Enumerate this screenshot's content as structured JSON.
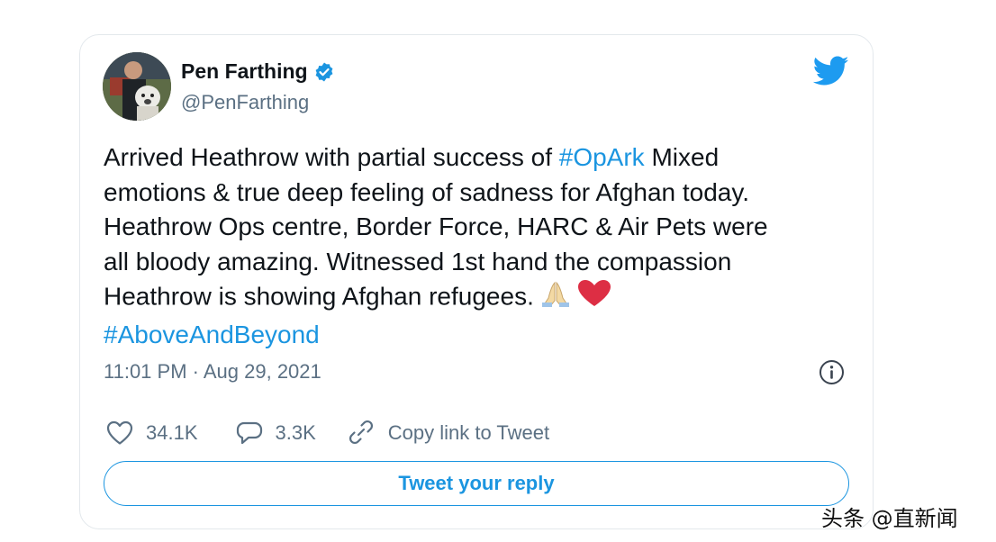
{
  "tweet": {
    "author": {
      "name": "Pen Farthing",
      "handle": "@PenFarthing",
      "verified": true
    },
    "text_lines": [
      [
        {
          "t": "Arrived Heathrow with partial success of ",
          "tag": false
        },
        {
          "t": "#OpArk",
          "tag": true
        },
        {
          "t": " Mixed",
          "tag": false
        }
      ],
      [
        {
          "t": "emotions & true deep feeling of sadness for Afghan today.",
          "tag": false
        }
      ],
      [
        {
          "t": "Heathrow Ops centre, Border Force, HARC & Air Pets were",
          "tag": false
        }
      ],
      [
        {
          "t": "all bloody amazing. Witnessed 1st hand the compassion",
          "tag": false
        }
      ],
      [
        {
          "t": "Heathrow is showing Afghan refugees.",
          "tag": false
        }
      ],
      [
        {
          "t": "#AboveAndBeyond",
          "tag": true
        }
      ]
    ],
    "emojis": [
      "folded-hands",
      "red-heart"
    ],
    "timestamp": "11:01 PM · Aug 29, 2021",
    "likes": "34.1K",
    "replies": "3.3K",
    "copy_link_label": "Copy link to Tweet",
    "reply_button_label": "Tweet your reply"
  },
  "icons": {
    "brand": "twitter-bird-icon",
    "verified": "verified-badge-icon",
    "info": "info-icon",
    "like": "heart-outline-icon",
    "reply": "speech-bubble-icon",
    "link": "link-icon"
  },
  "colors": {
    "accent": "#1b95e0",
    "text": "#0f1419",
    "secondary": "#5b7083",
    "border": "#e3e8ec"
  },
  "watermark": "头条 @直新闻"
}
